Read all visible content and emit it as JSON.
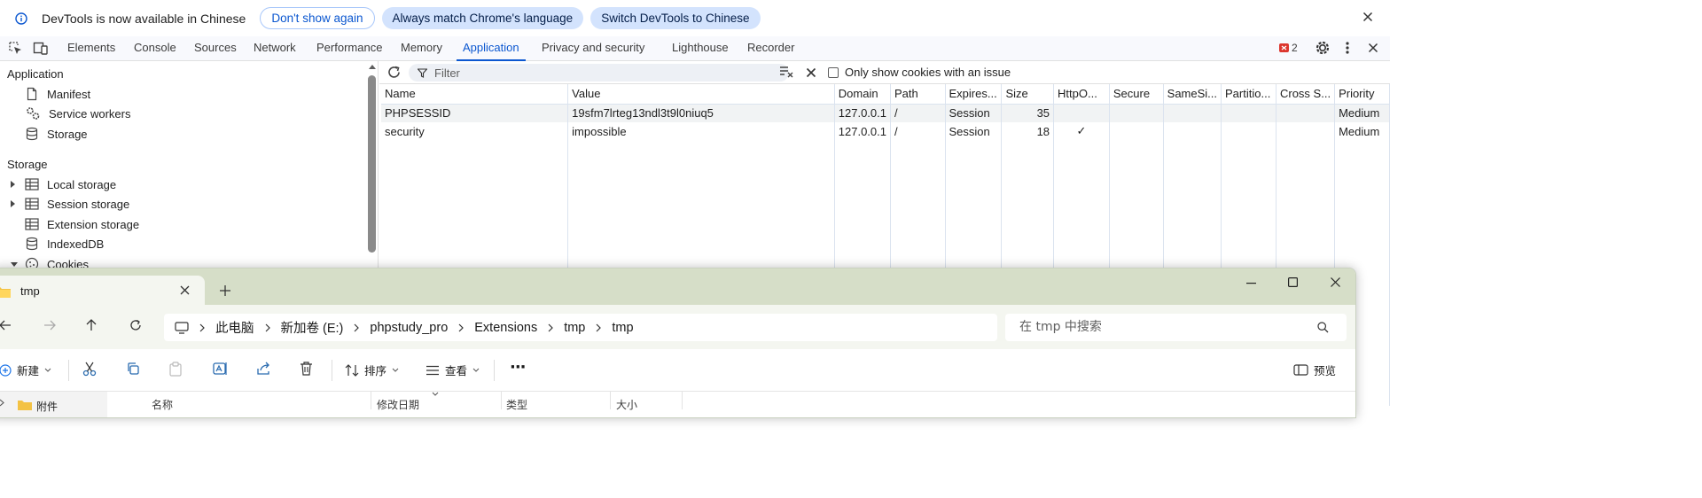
{
  "infobar": {
    "message": "DevTools is now available in Chinese",
    "btn_dont_show": "Don't show again",
    "btn_match": "Always match Chrome's language",
    "btn_switch": "Switch DevTools to Chinese"
  },
  "tabs": [
    {
      "label": "Elements"
    },
    {
      "label": "Console"
    },
    {
      "label": "Sources"
    },
    {
      "label": "Network"
    },
    {
      "label": "Performance"
    },
    {
      "label": "Memory"
    },
    {
      "label": "Application",
      "active": true
    },
    {
      "label": "Privacy and security"
    },
    {
      "label": "Lighthouse"
    },
    {
      "label": "Recorder"
    }
  ],
  "error_count": "2",
  "sidebar": {
    "application_header": "Application",
    "manifest": "Manifest",
    "service_workers": "Service workers",
    "storage_item": "Storage",
    "storage_header": "Storage",
    "local_storage": "Local storage",
    "session_storage": "Session storage",
    "extension_storage": "Extension storage",
    "indexeddb": "IndexedDB",
    "cookies": "Cookies"
  },
  "cookies_toolbar": {
    "filter_placeholder": "Filter",
    "only_issues_label": "Only show cookies with an issue"
  },
  "cookie_table": {
    "columns": [
      "Name",
      "Value",
      "Domain",
      "Path",
      "Expires...",
      "Size",
      "HttpO...",
      "Secure",
      "SameSi...",
      "Partitio...",
      "Cross S...",
      "Priority"
    ],
    "rows": [
      [
        "PHPSESSID",
        "19sfm7lrteg13ndl3t9l0niuq5",
        "127.0.0.1",
        "/",
        "Session",
        "35",
        "",
        "",
        "",
        "",
        "",
        "Medium"
      ],
      [
        "security",
        "impossible",
        "127.0.0.1",
        "/",
        "Session",
        "18",
        "✓",
        "",
        "",
        "",
        "",
        "Medium"
      ]
    ]
  },
  "explorer": {
    "tab_title": "tmp",
    "breadcrumb": [
      "此电脑",
      "新加卷 (E:)",
      "phpstudy_pro",
      "Extensions",
      "tmp",
      "tmp"
    ],
    "search_placeholder": "在 tmp 中搜索",
    "cmd_new": "新建",
    "cmd_sort": "排序",
    "cmd_view": "查看",
    "cmd_more": "···",
    "cmd_preview": "预览",
    "nav_item": "附件",
    "columns": [
      "名称",
      "修改日期",
      "类型",
      "大小"
    ]
  }
}
